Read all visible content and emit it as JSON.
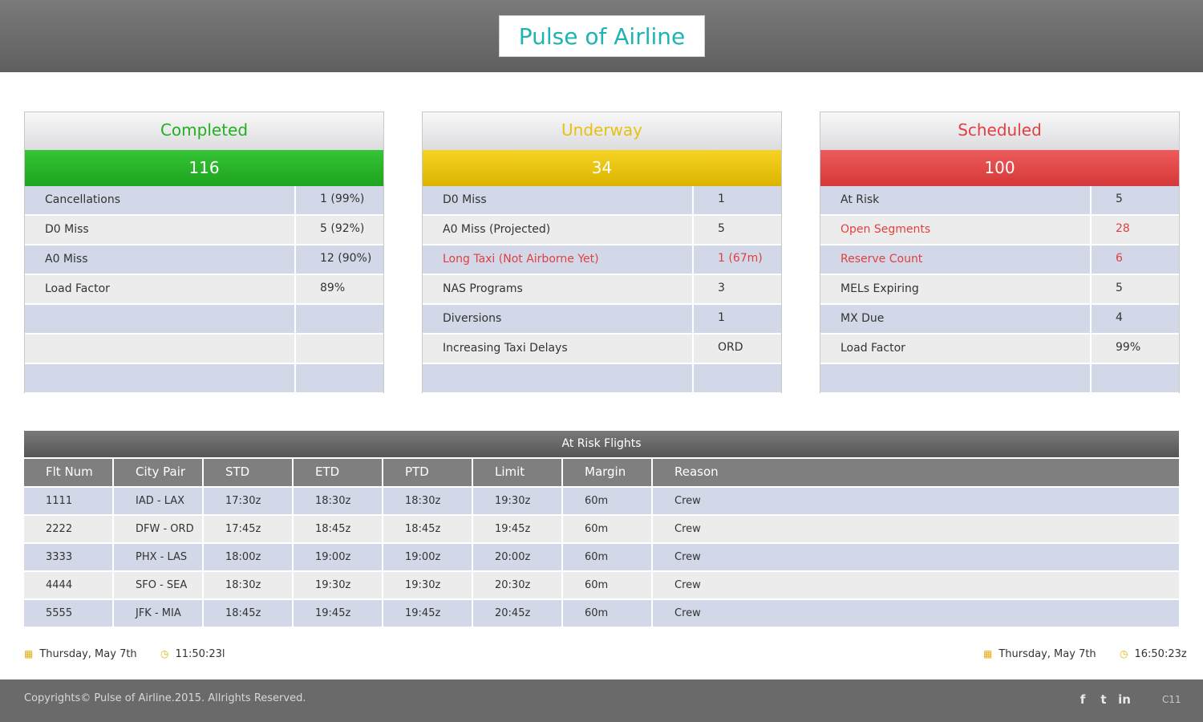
{
  "header": {
    "title": "Pulse of Airline"
  },
  "panels": {
    "completed": {
      "title": "Completed",
      "count": "116",
      "rows": [
        {
          "label": "Cancellations",
          "value": "1 (99%)"
        },
        {
          "label": "D0 Miss",
          "value": "5 (92%)"
        },
        {
          "label": "A0 Miss",
          "value": "12 (90%)"
        },
        {
          "label": "Load Factor",
          "value": "89%"
        },
        {
          "label": "",
          "value": ""
        },
        {
          "label": "",
          "value": ""
        },
        {
          "label": "",
          "value": ""
        }
      ]
    },
    "underway": {
      "title": "Underway",
      "count": "34",
      "rows": [
        {
          "label": "D0 Miss",
          "value": "1"
        },
        {
          "label": "A0 Miss (Projected)",
          "value": "5"
        },
        {
          "label": "Long Taxi (Not Airborne Yet)",
          "value": "1 (67m)"
        },
        {
          "label": "NAS Programs",
          "value": "3"
        },
        {
          "label": "Diversions",
          "value": "1"
        },
        {
          "label": "Increasing Taxi Delays",
          "value": "ORD"
        },
        {
          "label": "",
          "value": ""
        }
      ]
    },
    "scheduled": {
      "title": "Scheduled",
      "count": "100",
      "rows": [
        {
          "label": "At Risk",
          "value": "5"
        },
        {
          "label": "Open Segments",
          "value": "28"
        },
        {
          "label": "Reserve Count",
          "value": "6"
        },
        {
          "label": "MELs Expiring",
          "value": "5"
        },
        {
          "label": "MX Due",
          "value": "4"
        },
        {
          "label": "Load Factor",
          "value": "99%"
        },
        {
          "label": "",
          "value": ""
        }
      ]
    }
  },
  "risk_table": {
    "title": "At Risk Flights",
    "columns": [
      "Flt Num",
      "City Pair",
      "STD",
      "ETD",
      "PTD",
      "Limit",
      "Margin",
      "Reason"
    ],
    "rows": [
      [
        "1111",
        "IAD - LAX",
        "17:30z",
        "18:30z",
        "18:30z",
        "19:30z",
        "60m",
        "Crew"
      ],
      [
        "2222",
        "DFW - ORD",
        "17:45z",
        "18:45z",
        "18:45z",
        "19:45z",
        "60m",
        "Crew"
      ],
      [
        "3333",
        "PHX - LAS",
        "18:00z",
        "19:00z",
        "19:00z",
        "20:00z",
        "60m",
        "Crew"
      ],
      [
        "4444",
        "SFO - SEA",
        "18:30z",
        "19:30z",
        "19:30z",
        "20:30z",
        "60m",
        "Crew"
      ],
      [
        "5555",
        "JFK - MIA",
        "18:45z",
        "19:45z",
        "19:45z",
        "20:45z",
        "60m",
        "Crew"
      ]
    ]
  },
  "local_time": {
    "date": "Thursday, May 7th",
    "time": "11:50:23l"
  },
  "zulu_time": {
    "date": "Thursday, May 7th",
    "time": "16:50:23z"
  },
  "footer": {
    "copyright": "Copyrights© Pulse of Airline.2015.   Allrights Reserved.",
    "social": [
      "f",
      "t",
      "in"
    ],
    "code": "C11"
  },
  "colors": {
    "completed": "#22b022",
    "underway": "#e8c010",
    "scheduled": "#e04040",
    "title": "#1fb3b3",
    "alert": "#e04040"
  },
  "icons": [
    "calendar-icon",
    "clock-icon",
    "facebook-icon",
    "twitter-icon",
    "linkedin-icon"
  ]
}
